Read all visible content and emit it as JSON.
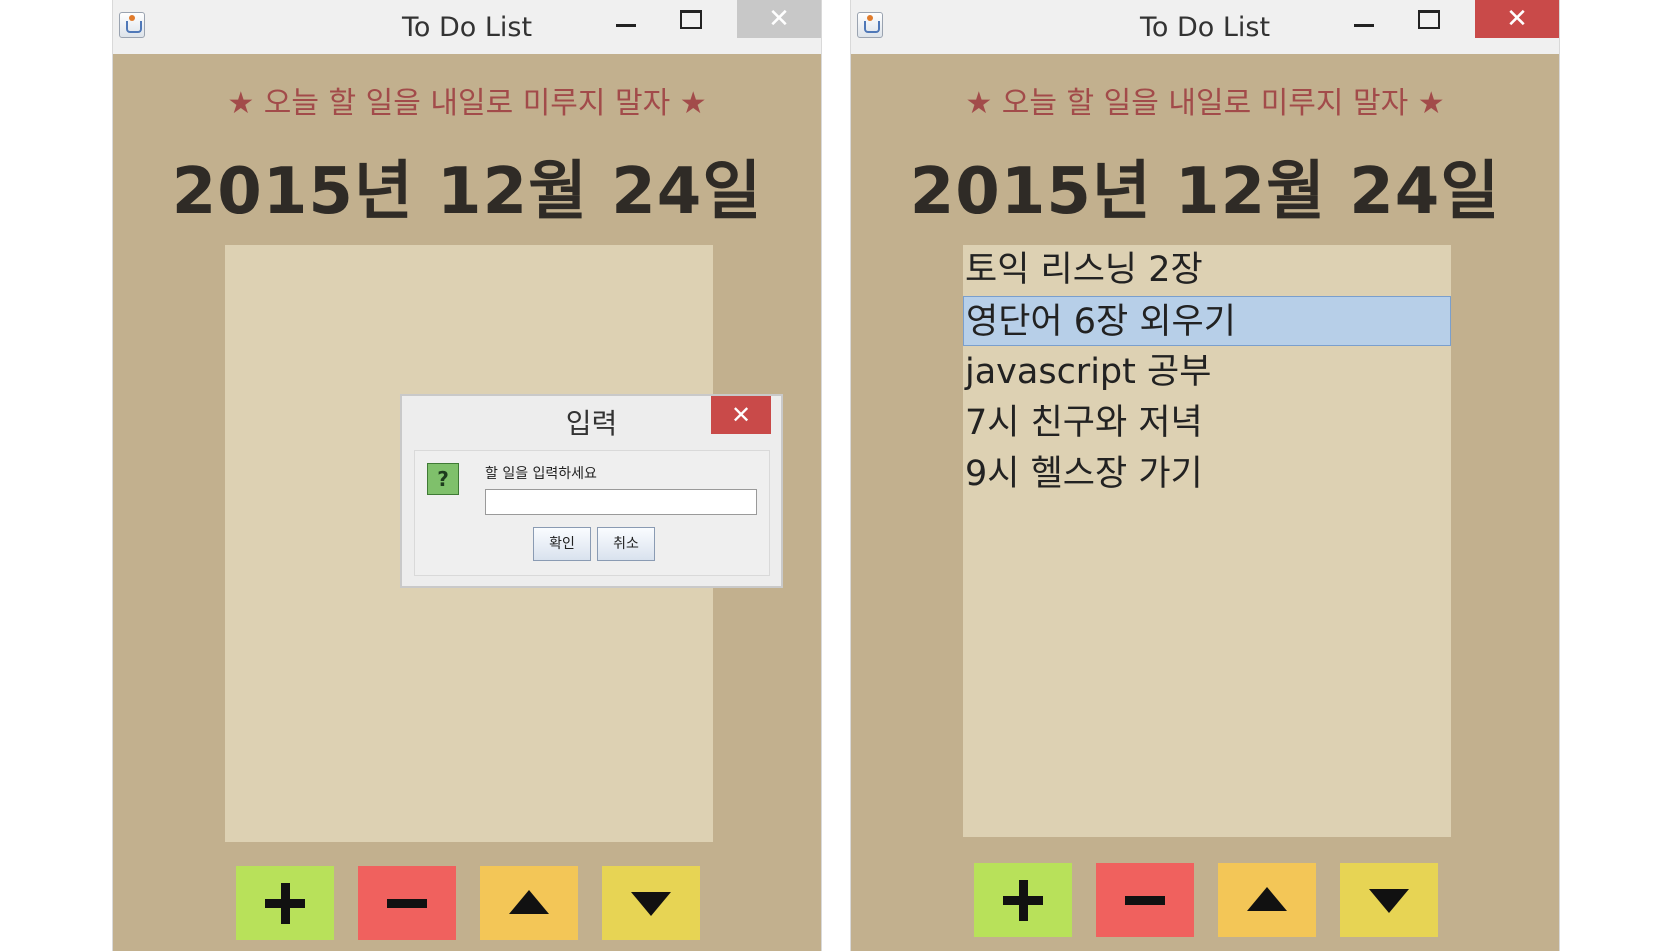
{
  "left_window": {
    "title": "To Do List",
    "close_glyph": "✕",
    "motto": "★ 오늘 할 일을 내일로 미루지 말자 ★",
    "date": "2015년 12월 24일",
    "list_items": [],
    "dialog": {
      "title": "입력",
      "close_glyph": "✕",
      "icon": "?",
      "prompt": "할 일을 입력하세요",
      "input_value": "",
      "ok_label": "확인",
      "cancel_label": "취소"
    }
  },
  "right_window": {
    "title": "To Do List",
    "close_glyph": "✕",
    "motto": "★ 오늘 할 일을 내일로 미루지 말자 ★",
    "date": "2015년 12월 24일",
    "selected_index": 1,
    "list_items": [
      "토익 리스닝 2장",
      "영단어 6장 외우기",
      "javascript 공부",
      "7시 친구와 저녁",
      "9시 헬스장 가기"
    ]
  },
  "buttons": {
    "add_icon": "plus-icon",
    "remove_icon": "minus-icon",
    "up_icon": "triangle-up-icon",
    "down_icon": "triangle-down-icon",
    "colors": {
      "add": "#b8e15a",
      "remove": "#f0615e",
      "up": "#f3c657",
      "down": "#e7d454"
    }
  },
  "colors": {
    "window_bg": "#c2b08e",
    "list_bg": "#ddd1b3",
    "motto": "#a24b4a",
    "selection": "#b7cfe8",
    "close_active": "#c94a49"
  }
}
